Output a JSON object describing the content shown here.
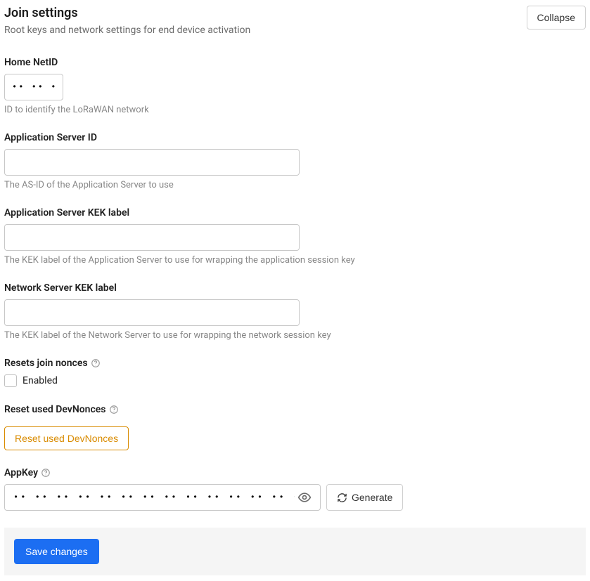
{
  "section": {
    "title": "Join settings",
    "description": "Root keys and network settings for end device activation",
    "collapse_label": "Collapse"
  },
  "home_netid": {
    "label": "Home NetID",
    "value": "•• •• ••",
    "help": "ID to identify the LoRaWAN network"
  },
  "app_server_id": {
    "label": "Application Server ID",
    "value": "",
    "help": "The AS-ID of the Application Server to use"
  },
  "app_server_kek": {
    "label": "Application Server KEK label",
    "value": "",
    "help": "The KEK label of the Application Server to use for wrapping the application session key"
  },
  "network_server_kek": {
    "label": "Network Server KEK label",
    "value": "",
    "help": "The KEK label of the Network Server to use for wrapping the network session key"
  },
  "resets_join_nonces": {
    "label": "Resets join nonces",
    "checkbox_label": "Enabled",
    "checked": false
  },
  "reset_devnonces": {
    "label": "Reset used DevNonces",
    "button_label": "Reset used DevNonces"
  },
  "appkey": {
    "label": "AppKey",
    "masked_value": "•• •• •• •• •• •• •• •• •• •• •• •• •• •• •• ••",
    "generate_label": "Generate"
  },
  "footer": {
    "save_label": "Save changes"
  }
}
